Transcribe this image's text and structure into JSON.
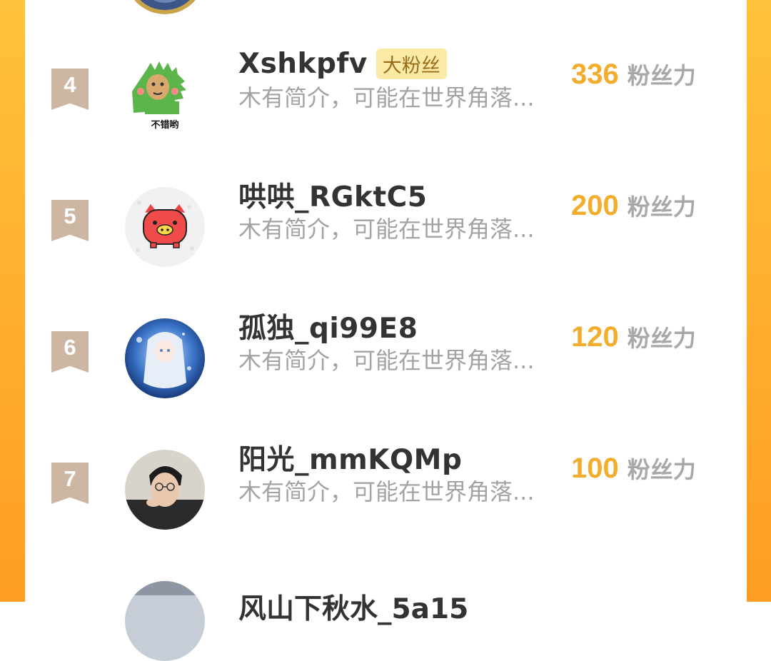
{
  "unit_label": "粉丝力",
  "rows": [
    {
      "rank": "4",
      "name": "Xshkpfv",
      "badge": "大粉丝",
      "bio": "木有简介，可能在世界角落...",
      "score": "336",
      "avatar_caption": "不错哟"
    },
    {
      "rank": "5",
      "name": "哄哄_RGktC5",
      "badge": "",
      "bio": "木有简介，可能在世界角落...",
      "score": "200"
    },
    {
      "rank": "6",
      "name": "孤独_qi99E8",
      "badge": "",
      "bio": "木有简介，可能在世界角落...",
      "score": "120"
    },
    {
      "rank": "7",
      "name": "阳光_mmKQMp",
      "badge": "",
      "bio": "木有简介，可能在世界角落...",
      "score": "100"
    }
  ],
  "partial_next_name": "风山下秋水_5a15",
  "colors": {
    "frame": "#ffab2c",
    "score": "#f2ad2c",
    "rank_badge": "#cdb7a3",
    "fan_badge_bg": "#fbeaa6"
  }
}
